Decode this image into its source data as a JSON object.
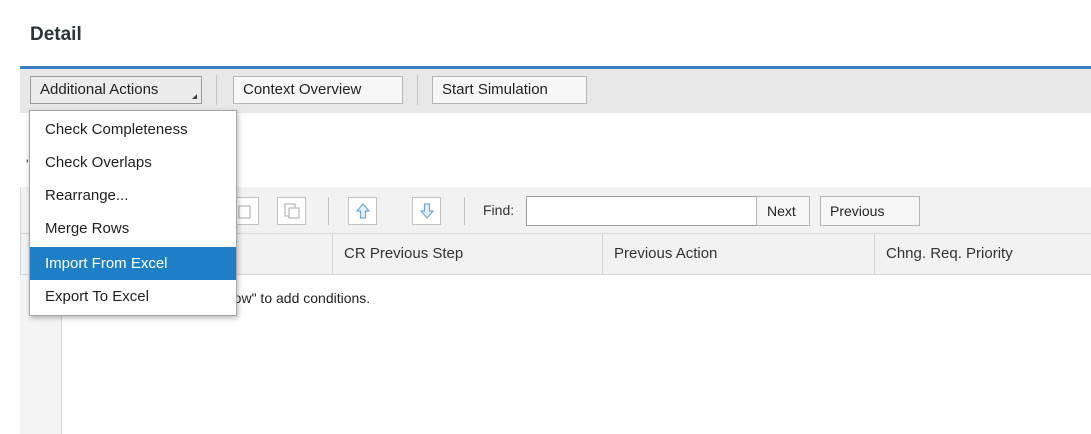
{
  "page": {
    "title": "Detail"
  },
  "toolbar": {
    "additional_actions": "Additional Actions",
    "context_overview": "Context Overview",
    "start_simulation": "Start Simulation"
  },
  "menu": {
    "items": [
      {
        "label": "Check Completeness"
      },
      {
        "label": "Check Overlaps"
      },
      {
        "label": "Rearrange..."
      },
      {
        "label": "Merge Rows"
      },
      {
        "label": "Import From Excel",
        "highlighted": true
      },
      {
        "label": "Export To Excel"
      }
    ]
  },
  "table_toolbar": {
    "find_label": "Find:",
    "find_value": "",
    "next_label": "Next",
    "previous_label": "Previous",
    "icons": [
      "copy-icon",
      "paste-icon",
      "move-up-icon",
      "move-down-icon"
    ]
  },
  "table": {
    "columns": [
      "CR Previous Step",
      "Previous Action",
      "Chng. Req. Priority"
    ],
    "empty_message": "o rows. Use \"Insert New Row\" to add conditions."
  },
  "colors": {
    "accent": "#3b7ec0",
    "menu_highlight": "#1e7fc7",
    "arrow_icon": "#6fa8dc"
  }
}
